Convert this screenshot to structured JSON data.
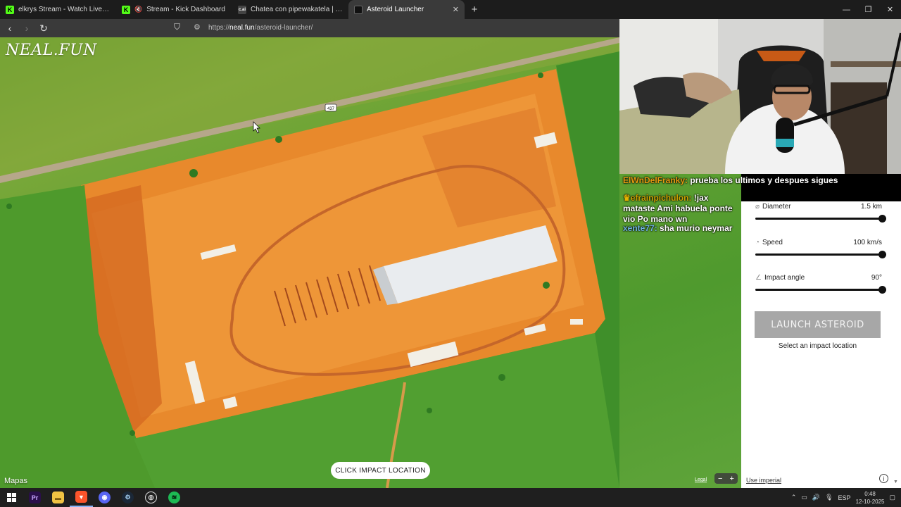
{
  "browser": {
    "tabs": [
      {
        "title": "elkrys Stream - Watch Live on Kick",
        "favicon": "kick-icon",
        "color": "#53fc18",
        "active": false
      },
      {
        "title": "Stream - Kick Dashboard",
        "favicon": "kick-icon",
        "color": "#53fc18",
        "active": false,
        "muted": true
      },
      {
        "title": "Chatea con pipewakatela | character.ai",
        "favicon": "character-ai-icon",
        "color": "#333333",
        "active": false
      },
      {
        "title": "Asteroid Launcher",
        "favicon": "neal-fun-icon",
        "color": "#222222",
        "active": true
      }
    ],
    "url_prefix": "https://",
    "url_host": "neal.fun",
    "url_path": "/asteroid-launcher/"
  },
  "map": {
    "logo": "NEAL.FUN",
    "attribution": "Mapas",
    "road_sign": "437",
    "click_prompt": "CLICK IMPACT LOCATION",
    "legal": "Legal",
    "zoom_out": "−",
    "zoom_in": "+"
  },
  "chat": [
    {
      "user": "ElWnDelFranky:",
      "text": "prueba los ultimos y despues sigues"
    },
    {
      "user": "efrainpichulon:",
      "text": "!jax mataste Ami habuela ponte vio Po mano wn"
    },
    {
      "user": "xente77:",
      "text": "sha murio neymar"
    }
  ],
  "panel": {
    "diameter": {
      "label": "Diameter",
      "value": "1.5 km",
      "fraction": 1.0
    },
    "speed": {
      "label": "Speed",
      "value": "100 km/s",
      "fraction": 1.0
    },
    "angle": {
      "label": "Impact angle",
      "value": "90°",
      "fraction": 1.0
    },
    "launch_label": "LAUNCH ASTEROID",
    "hint": "Select an impact location",
    "imperial_link": "Use imperial",
    "info": "i"
  },
  "taskbar": {
    "language": "ESP",
    "time": "0:48",
    "date": "12-10-2025"
  }
}
